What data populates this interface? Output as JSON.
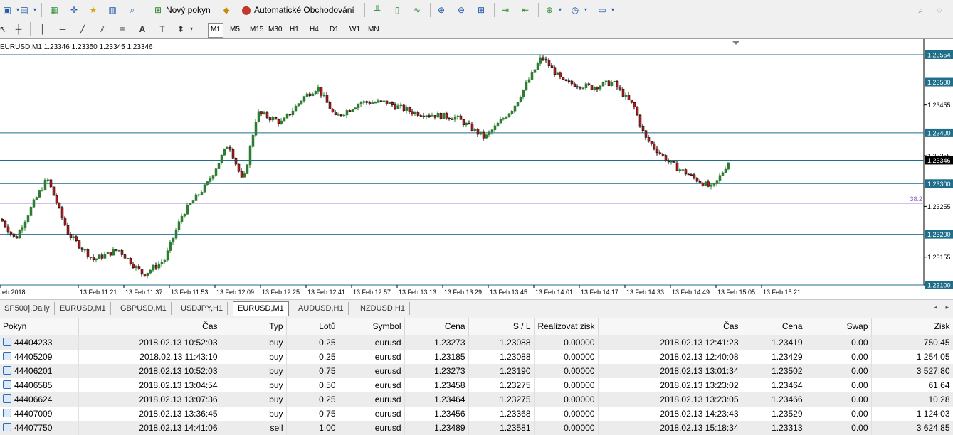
{
  "toolbar": {
    "new_order": "Nový pokyn",
    "auto_trading": "Automatické Obchodování"
  },
  "timeframes": [
    "M1",
    "M5",
    "M15",
    "M30",
    "H1",
    "H4",
    "D1",
    "W1",
    "MN"
  ],
  "chart": {
    "header": "EURUSD,M1  1.23346 1.23350 1.23345 1.23346",
    "fib_label": "38.2",
    "current_price": "1.23346",
    "price_labels": [
      {
        "text": "1.23554",
        "hl": true
      },
      {
        "text": "1.23500",
        "hl": true
      },
      {
        "text": "1.23455",
        "hl": false
      },
      {
        "text": "1.23400",
        "hl": true
      },
      {
        "text": "1.23355",
        "hl": false
      },
      {
        "text": "1.23300",
        "hl": true
      },
      {
        "text": "1.23255",
        "hl": false
      },
      {
        "text": "1.23200",
        "hl": true
      },
      {
        "text": "1.23155",
        "hl": false
      },
      {
        "text": "1.23100",
        "hl": true
      }
    ],
    "time_labels": [
      "eb 2018",
      "13 Feb 11:21",
      "13 Feb 11:37",
      "13 Feb 11:53",
      "13 Feb 12:09",
      "13 Feb 12:25",
      "13 Feb 12:41",
      "13 Feb 12:57",
      "13 Feb 13:13",
      "13 Feb 13:29",
      "13 Feb 13:45",
      "13 Feb 14:01",
      "13 Feb 14:17",
      "13 Feb 14:33",
      "13 Feb 14:49",
      "13 Feb 15:05",
      "13 Feb 15:21"
    ]
  },
  "chart_tabs": [
    {
      "label": "SP500],Daily",
      "active": false
    },
    {
      "label": "EURUSD,M1",
      "active": false
    },
    {
      "label": "GBPUSD,M1",
      "active": false
    },
    {
      "label": "USDJPY,H1",
      "active": false
    },
    {
      "label": "EURUSD,M1",
      "active": true
    },
    {
      "label": "AUDUSD,H1",
      "active": false
    },
    {
      "label": "NZDUSD,H1",
      "active": false
    }
  ],
  "table": {
    "headers": [
      "Pokyn",
      "Čas",
      "Typ",
      "Lotů",
      "Symbol",
      "Cena",
      "S / L",
      "Realizovat zisk",
      "Čas",
      "Cena",
      "Swap",
      "Zisk"
    ],
    "rows": [
      [
        "44404233",
        "2018.02.13 10:52:03",
        "buy",
        "0.25",
        "eurusd",
        "1.23273",
        "1.23088",
        "0.00000",
        "2018.02.13 12:41:23",
        "1.23419",
        "0.00",
        "750.45"
      ],
      [
        "44405209",
        "2018.02.13 11:43:10",
        "buy",
        "0.25",
        "eurusd",
        "1.23185",
        "1.23088",
        "0.00000",
        "2018.02.13 12:40:08",
        "1.23429",
        "0.00",
        "1 254.05"
      ],
      [
        "44406201",
        "2018.02.13 10:52:03",
        "buy",
        "0.75",
        "eurusd",
        "1.23273",
        "1.23190",
        "0.00000",
        "2018.02.13 13:01:34",
        "1.23502",
        "0.00",
        "3 527.80"
      ],
      [
        "44406585",
        "2018.02.13 13:04:54",
        "buy",
        "0.50",
        "eurusd",
        "1.23458",
        "1.23275",
        "0.00000",
        "2018.02.13 13:23:02",
        "1.23464",
        "0.00",
        "61.64"
      ],
      [
        "44406624",
        "2018.02.13 13:07:36",
        "buy",
        "0.25",
        "eurusd",
        "1.23464",
        "1.23275",
        "0.00000",
        "2018.02.13 13:23:05",
        "1.23466",
        "0.00",
        "10.28"
      ],
      [
        "44407009",
        "2018.02.13 13:36:45",
        "buy",
        "0.75",
        "eurusd",
        "1.23456",
        "1.23368",
        "0.00000",
        "2018.02.13 14:23:43",
        "1.23529",
        "0.00",
        "1 124.03"
      ],
      [
        "44407750",
        "2018.02.13 14:41:06",
        "sell",
        "1.00",
        "eurusd",
        "1.23489",
        "1.23581",
        "0.00000",
        "2018.02.13 15:18:34",
        "1.23313",
        "0.00",
        "3 624.85"
      ]
    ]
  }
}
